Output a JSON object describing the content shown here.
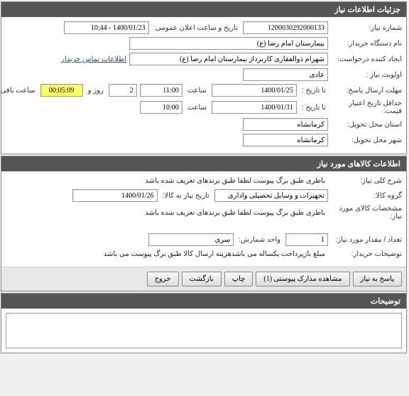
{
  "panel1": {
    "title": "جزئیات اطلاعات نیاز",
    "rows": {
      "niaz_no_label": "شماره نیاز:",
      "niaz_no": "1200030292000133",
      "announce_label": "تاریخ و ساعت اعلان عمومی:",
      "announce_value": "1400/01/23 - 10:44",
      "buyer_label": "نام دستگاه خریدار:",
      "buyer_value": "بیمارستان امام رضا (ع)",
      "creator_label": "ایجاد کننده درخواست:",
      "creator_value": "شهرام ذوالفقاری کاربرداز بیمارستان امام رضا (ع)",
      "contact_link": "اطلاعات تماس خریدار",
      "priority_label": "اولویت نیاز :",
      "priority_value": "عادی",
      "deadline_label": "مهلت ارسال پاسخ:",
      "deadline_to": "تا تاریخ :",
      "deadline_date": "1400/01/25",
      "time_label": "ساعت",
      "deadline_time": "11:00",
      "days_value": "2",
      "days_label": "روز و",
      "remain_time": "00:05:09",
      "remain_label": "ساعت باقی مانده",
      "min_credit_label": "حداقل تاریخ اعتبار قیمت:",
      "min_credit_to": "تا تاریخ :",
      "min_credit_date": "1400/01/31",
      "min_credit_time": "10:00",
      "delivery_state_label": "استان محل تحویل:",
      "delivery_state": "کرمانشاه",
      "delivery_city_label": "شهر محل تحویل:",
      "delivery_city": "کرمانشاه"
    }
  },
  "panel2": {
    "title": "اطلاعات کالاهای مورد نیاز",
    "rows": {
      "desc_label": "شرح کلی نیاز:",
      "desc_value": "باطری طبق برگ پیوست لطفا طبق برندهای تعریف شده باشد",
      "group_label": "گروه کالا:",
      "group_value": "تجهیزات و وسایل تحصیلی واداری",
      "need_date_label": "تاریخ نیاز به کالا:",
      "need_date": "1400/01/26",
      "spec_label": "مشخصات کالای مورد نیاز:",
      "spec_value": "باطری طبق برگ پیوست لطفا طبق برندهای تعریف شده باشد",
      "qty_label": "تعداد / مقدار مورد نیاز:",
      "qty_value": "1",
      "unit_label": "واحد شمارش:",
      "unit_value": "سری",
      "buyer_notes_label": "توضیحات خریدار:",
      "buyer_notes": "مبلغ بازپرداخت یکساله می باشدهزینه ارسال کالا طبق برگ پیوست می باشد"
    }
  },
  "buttons": {
    "respond": "پاسخ به نیاز",
    "attachments": "مشاهده مدارک پیوستی (1)",
    "print": "چاپ",
    "back": "بازگشت",
    "exit": "خروج"
  },
  "panel3": {
    "title": "توضیحات"
  }
}
